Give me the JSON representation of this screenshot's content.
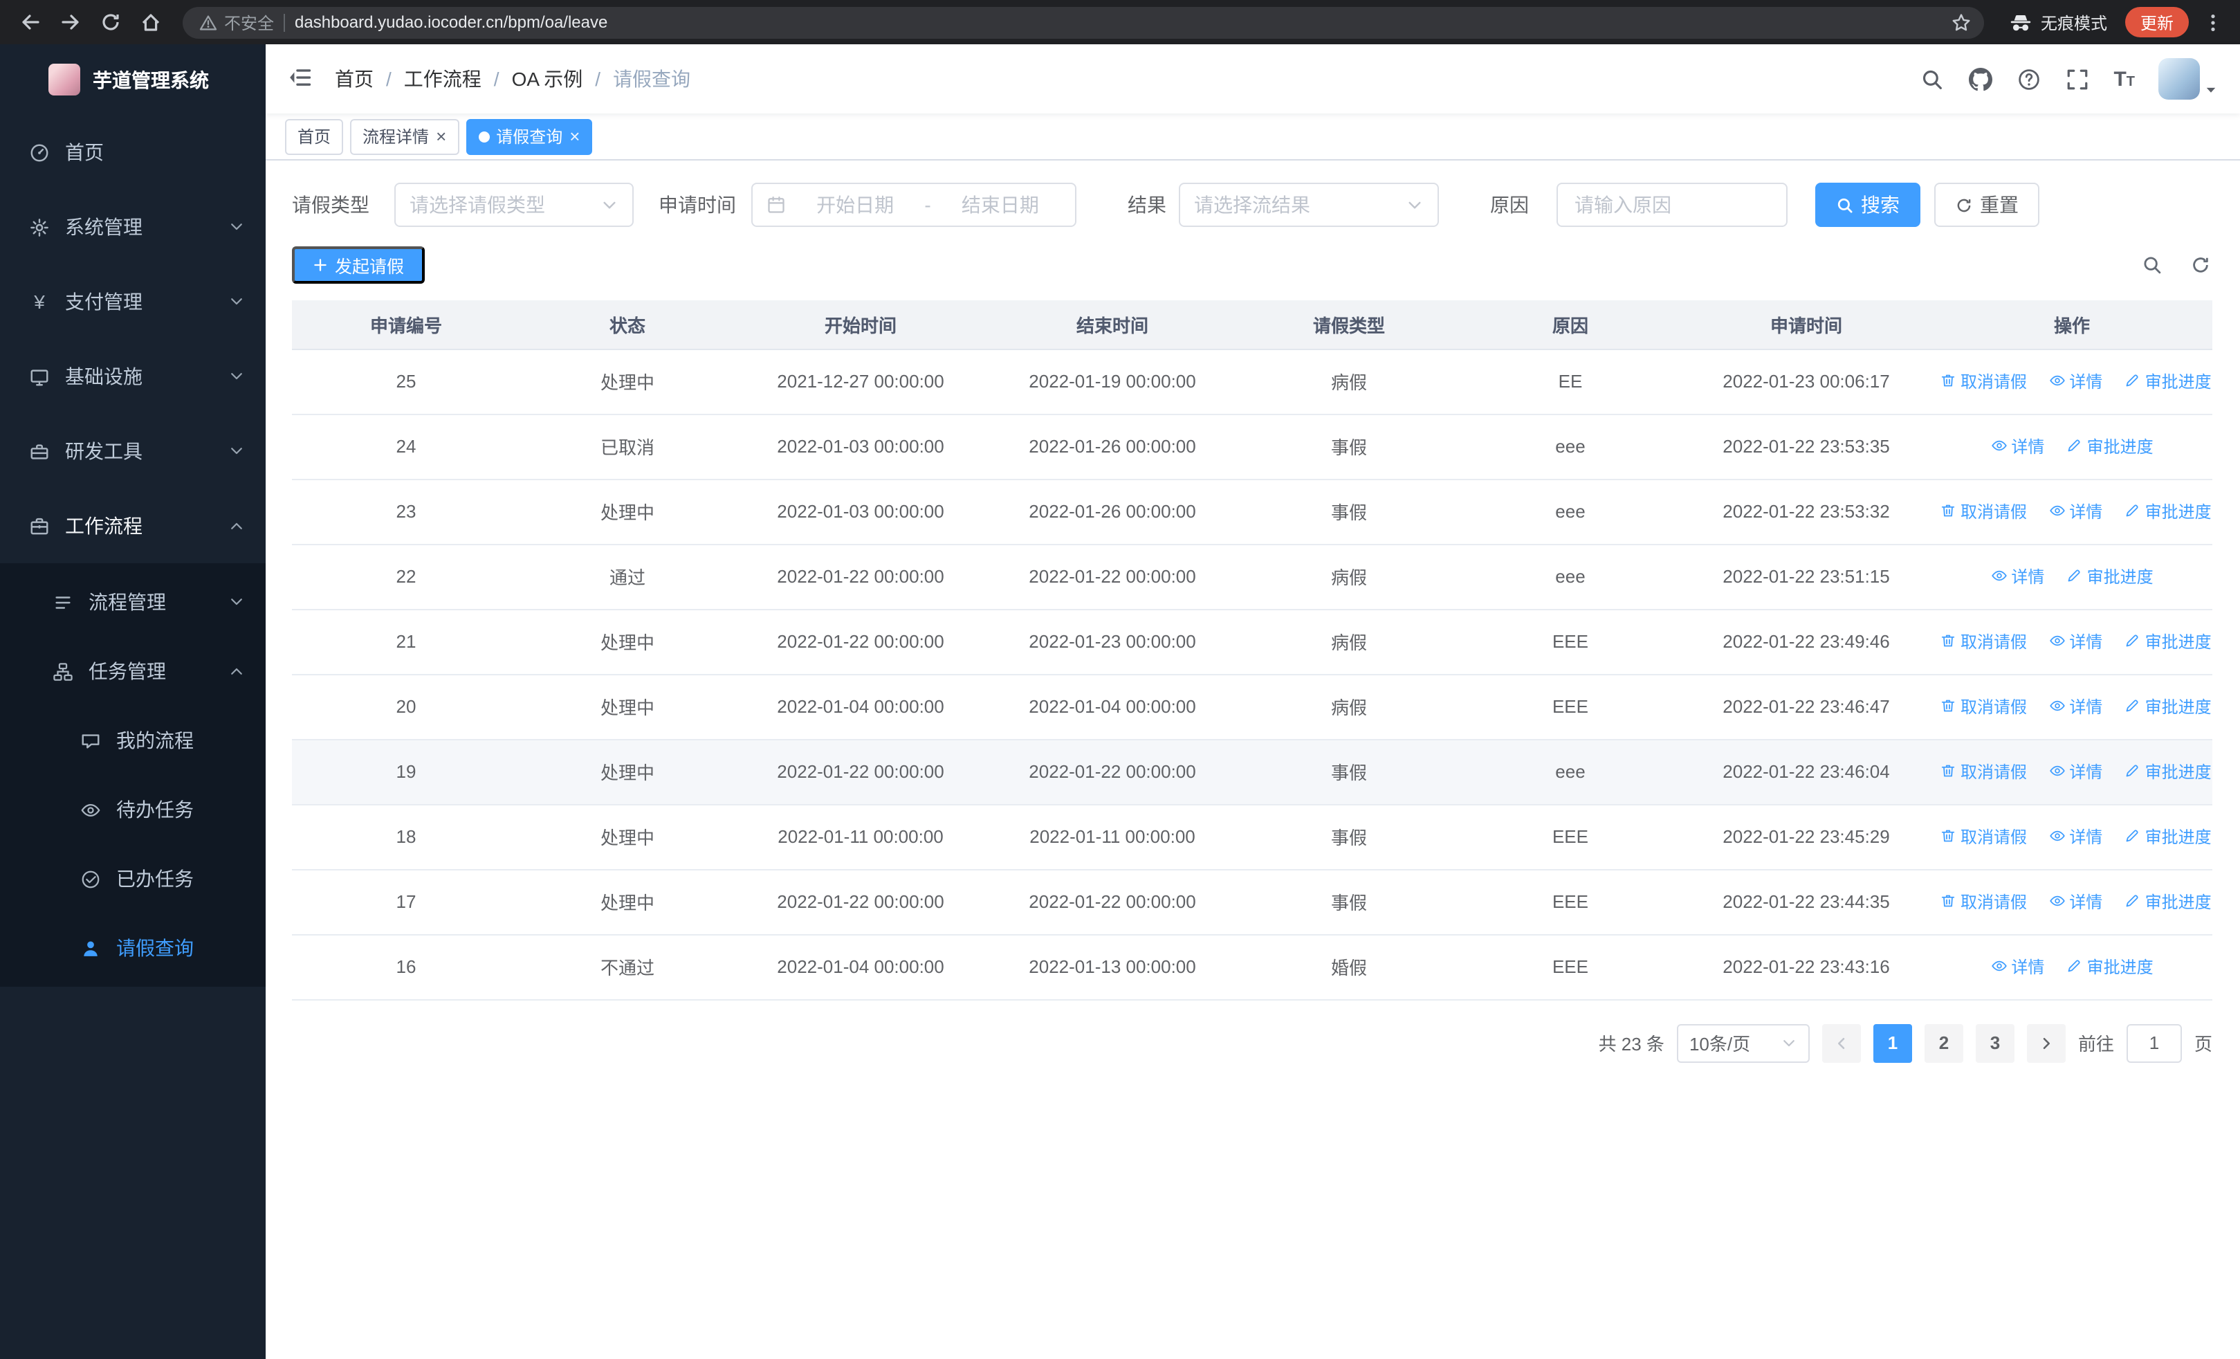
{
  "theme": {
    "primary": "#409eff",
    "sidebar_bg": "#18222f",
    "sidebar_submenu_bg": "#101823",
    "update_badge": "#e0543e",
    "table_header_bg": "#f1f3f6"
  },
  "browser": {
    "security_label": "不安全",
    "url": "dashboard.yudao.iocoder.cn/bpm/oa/leave",
    "incognito_label": "无痕模式",
    "update_label": "更新"
  },
  "sidebar": {
    "logo_title": "芋道管理系统",
    "items": [
      {
        "label": "首页"
      },
      {
        "label": "系统管理"
      },
      {
        "label": "支付管理"
      },
      {
        "label": "基础设施"
      },
      {
        "label": "研发工具"
      },
      {
        "label": "工作流程"
      }
    ],
    "workflow_children": [
      {
        "label": "流程管理"
      },
      {
        "label": "任务管理"
      }
    ],
    "task_children": [
      {
        "label": "我的流程"
      },
      {
        "label": "待办任务"
      },
      {
        "label": "已办任务"
      },
      {
        "label": "请假查询"
      }
    ]
  },
  "header": {
    "breadcrumb": [
      "首页",
      "工作流程",
      "OA 示例",
      "请假查询"
    ]
  },
  "tabs": [
    {
      "label": "首页",
      "active": false,
      "closable": false
    },
    {
      "label": "流程详情",
      "active": false,
      "closable": true
    },
    {
      "label": "请假查询",
      "active": true,
      "closable": true
    }
  ],
  "filters": {
    "leave_type_label": "请假类型",
    "leave_type_placeholder": "请选择请假类型",
    "apply_time_label": "申请时间",
    "start_date_placeholder": "开始日期",
    "range_separator": "-",
    "end_date_placeholder": "结束日期",
    "result_label": "结果",
    "result_placeholder": "请选择流结果",
    "reason_label": "原因",
    "reason_placeholder": "请输入原因",
    "search_label": "搜索",
    "reset_label": "重置"
  },
  "toolbar": {
    "create_label": "发起请假"
  },
  "table": {
    "columns": [
      "申请编号",
      "状态",
      "开始时间",
      "结束时间",
      "请假类型",
      "原因",
      "申请时间",
      "操作"
    ],
    "action_labels": {
      "cancel": "取消请假",
      "detail": "详情",
      "progress": "审批进度"
    },
    "rows": [
      {
        "id": "25",
        "status": "处理中",
        "start": "2021-12-27 00:00:00",
        "end": "2022-01-19 00:00:00",
        "type": "病假",
        "reason": "EE",
        "applied": "2022-01-23 00:06:17",
        "cancellable": true,
        "highlighted": false
      },
      {
        "id": "24",
        "status": "已取消",
        "start": "2022-01-03 00:00:00",
        "end": "2022-01-26 00:00:00",
        "type": "事假",
        "reason": "eee",
        "applied": "2022-01-22 23:53:35",
        "cancellable": false,
        "highlighted": false
      },
      {
        "id": "23",
        "status": "处理中",
        "start": "2022-01-03 00:00:00",
        "end": "2022-01-26 00:00:00",
        "type": "事假",
        "reason": "eee",
        "applied": "2022-01-22 23:53:32",
        "cancellable": true,
        "highlighted": false
      },
      {
        "id": "22",
        "status": "通过",
        "start": "2022-01-22 00:00:00",
        "end": "2022-01-22 00:00:00",
        "type": "病假",
        "reason": "eee",
        "applied": "2022-01-22 23:51:15",
        "cancellable": false,
        "highlighted": false
      },
      {
        "id": "21",
        "status": "处理中",
        "start": "2022-01-22 00:00:00",
        "end": "2022-01-23 00:00:00",
        "type": "病假",
        "reason": "EEE",
        "applied": "2022-01-22 23:49:46",
        "cancellable": true,
        "highlighted": false
      },
      {
        "id": "20",
        "status": "处理中",
        "start": "2022-01-04 00:00:00",
        "end": "2022-01-04 00:00:00",
        "type": "病假",
        "reason": "EEE",
        "applied": "2022-01-22 23:46:47",
        "cancellable": true,
        "highlighted": false
      },
      {
        "id": "19",
        "status": "处理中",
        "start": "2022-01-22 00:00:00",
        "end": "2022-01-22 00:00:00",
        "type": "事假",
        "reason": "eee",
        "applied": "2022-01-22 23:46:04",
        "cancellable": true,
        "highlighted": true
      },
      {
        "id": "18",
        "status": "处理中",
        "start": "2022-01-11 00:00:00",
        "end": "2022-01-11 00:00:00",
        "type": "事假",
        "reason": "EEE",
        "applied": "2022-01-22 23:45:29",
        "cancellable": true,
        "highlighted": false
      },
      {
        "id": "17",
        "status": "处理中",
        "start": "2022-01-22 00:00:00",
        "end": "2022-01-22 00:00:00",
        "type": "事假",
        "reason": "EEE",
        "applied": "2022-01-22 23:44:35",
        "cancellable": true,
        "highlighted": false
      },
      {
        "id": "16",
        "status": "不通过",
        "start": "2022-01-04 00:00:00",
        "end": "2022-01-13 00:00:00",
        "type": "婚假",
        "reason": "EEE",
        "applied": "2022-01-22 23:43:16",
        "cancellable": false,
        "highlighted": false
      }
    ]
  },
  "pagination": {
    "total_label": "共 23 条",
    "page_size_label": "10条/页",
    "pages": [
      "1",
      "2",
      "3"
    ],
    "active_page": "1",
    "goto_label": "前往",
    "goto_value": "1",
    "unit_label": "页"
  }
}
